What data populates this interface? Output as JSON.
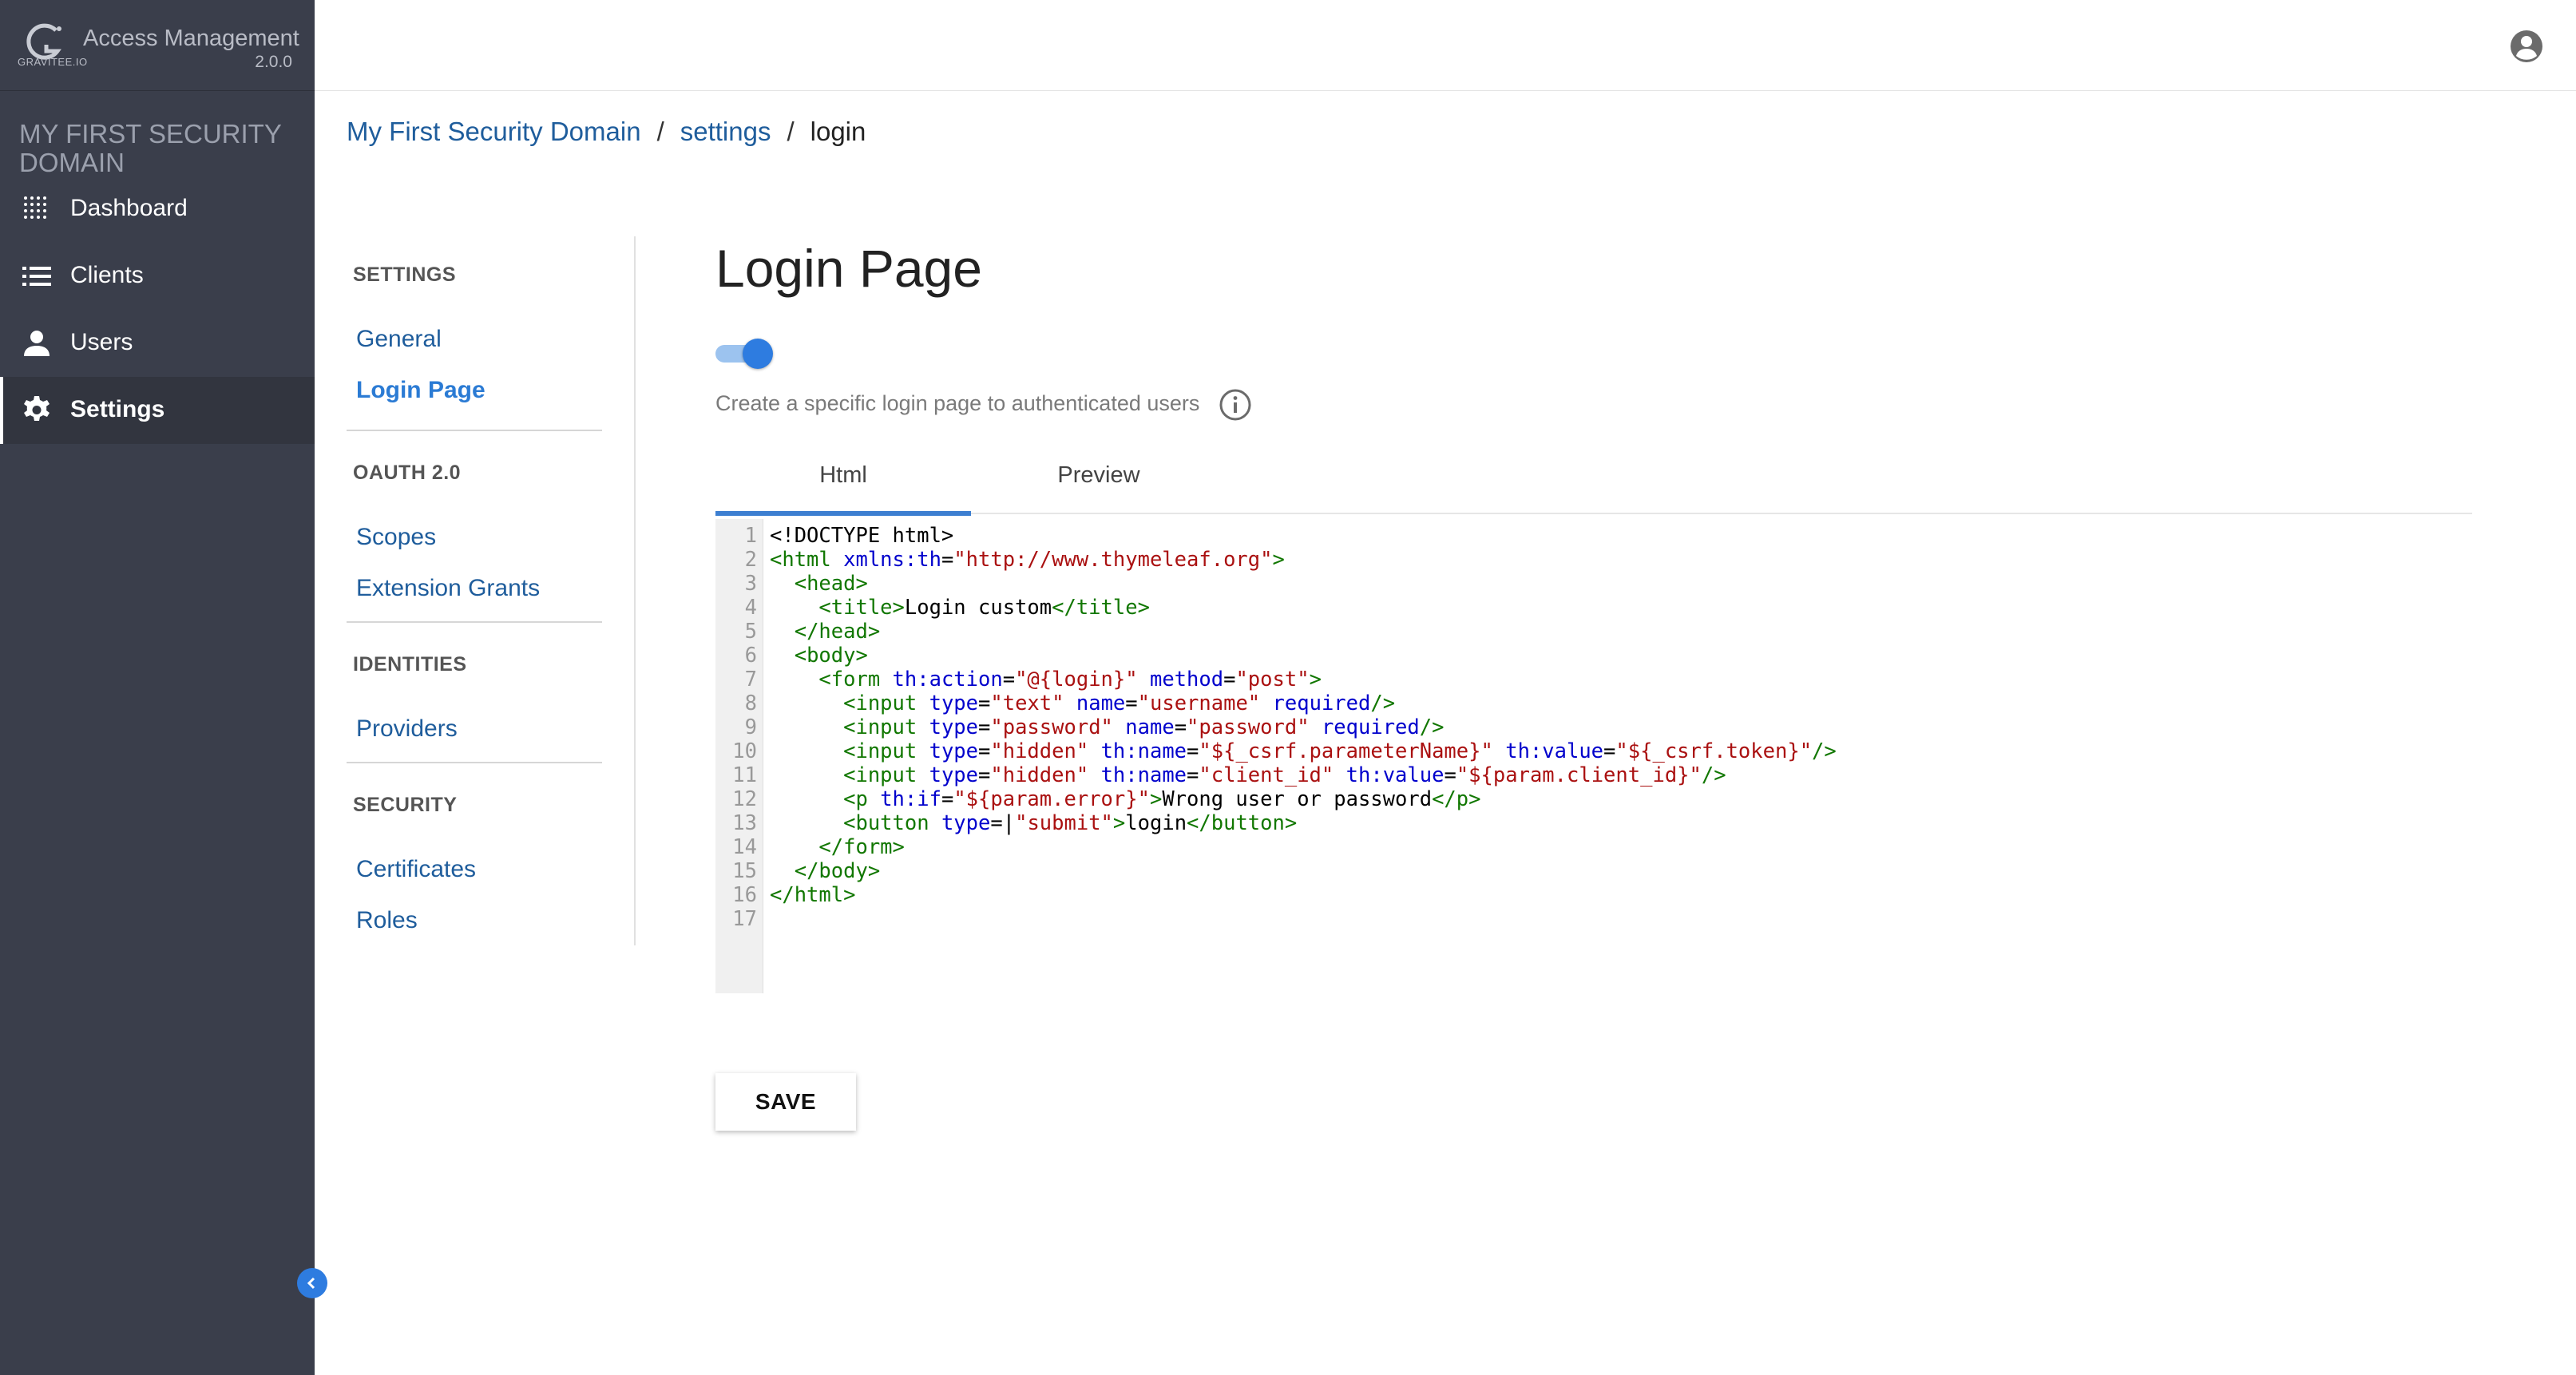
{
  "app": {
    "logo_text": "GRAVITEE.IO",
    "name": "Access Management",
    "version": "2.0.0"
  },
  "sidebar": {
    "domain_title": "MY FIRST SECURITY DOMAIN",
    "items": [
      {
        "label": "Dashboard",
        "icon": "dashboard-dots-icon",
        "active": false
      },
      {
        "label": "Clients",
        "icon": "list-icon",
        "active": false
      },
      {
        "label": "Users",
        "icon": "person-icon",
        "active": false
      },
      {
        "label": "Settings",
        "icon": "gear-icon",
        "active": true
      }
    ]
  },
  "breadcrumb": {
    "domain": "My First Security Domain",
    "settings": "settings",
    "current": "login",
    "separator": "/"
  },
  "subnav": {
    "sections": [
      {
        "title": "SETTINGS",
        "links": [
          {
            "label": "General",
            "active": false
          },
          {
            "label": "Login Page",
            "active": true
          }
        ]
      },
      {
        "title": "OAUTH 2.0",
        "links": [
          {
            "label": "Scopes",
            "active": false
          },
          {
            "label": "Extension Grants",
            "active": false
          }
        ]
      },
      {
        "title": "IDENTITIES",
        "links": [
          {
            "label": "Providers",
            "active": false
          }
        ]
      },
      {
        "title": "SECURITY",
        "links": [
          {
            "label": "Certificates",
            "active": false
          },
          {
            "label": "Roles",
            "active": false
          }
        ]
      }
    ]
  },
  "main": {
    "title": "Login Page",
    "toggle_enabled": true,
    "toggle_description": "Create a specific login page to authenticated users",
    "tabs": [
      {
        "label": "Html",
        "active": true
      },
      {
        "label": "Preview",
        "active": false
      }
    ],
    "editor_lines": [
      [
        {
          "t": "txt",
          "v": "<!DOCTYPE html>"
        }
      ],
      [
        {
          "t": "tag",
          "v": "<html "
        },
        {
          "t": "attr",
          "v": "xmlns:th"
        },
        {
          "t": "txt",
          "v": "="
        },
        {
          "t": "str",
          "v": "\"http://www.thymeleaf.org\""
        },
        {
          "t": "tag",
          "v": ">"
        }
      ],
      [
        {
          "t": "txt",
          "v": "  "
        },
        {
          "t": "tag",
          "v": "<head>"
        }
      ],
      [
        {
          "t": "txt",
          "v": "    "
        },
        {
          "t": "tag",
          "v": "<title>"
        },
        {
          "t": "txt",
          "v": "Login custom"
        },
        {
          "t": "tag",
          "v": "</title>"
        }
      ],
      [
        {
          "t": "txt",
          "v": "  "
        },
        {
          "t": "tag",
          "v": "</head>"
        }
      ],
      [
        {
          "t": "txt",
          "v": "  "
        },
        {
          "t": "tag",
          "v": "<body>"
        }
      ],
      [
        {
          "t": "txt",
          "v": "    "
        },
        {
          "t": "tag",
          "v": "<form "
        },
        {
          "t": "attr",
          "v": "th:action"
        },
        {
          "t": "txt",
          "v": "="
        },
        {
          "t": "str",
          "v": "\"@{login}\""
        },
        {
          "t": "txt",
          "v": " "
        },
        {
          "t": "attr",
          "v": "method"
        },
        {
          "t": "txt",
          "v": "="
        },
        {
          "t": "str",
          "v": "\"post\""
        },
        {
          "t": "tag",
          "v": ">"
        }
      ],
      [
        {
          "t": "txt",
          "v": "      "
        },
        {
          "t": "tag",
          "v": "<input "
        },
        {
          "t": "attr",
          "v": "type"
        },
        {
          "t": "txt",
          "v": "="
        },
        {
          "t": "str",
          "v": "\"text\""
        },
        {
          "t": "txt",
          "v": " "
        },
        {
          "t": "attr",
          "v": "name"
        },
        {
          "t": "txt",
          "v": "="
        },
        {
          "t": "str",
          "v": "\"username\""
        },
        {
          "t": "txt",
          "v": " "
        },
        {
          "t": "attr",
          "v": "required"
        },
        {
          "t": "tag",
          "v": "/>"
        }
      ],
      [
        {
          "t": "txt",
          "v": "      "
        },
        {
          "t": "tag",
          "v": "<input "
        },
        {
          "t": "attr",
          "v": "type"
        },
        {
          "t": "txt",
          "v": "="
        },
        {
          "t": "str",
          "v": "\"password\""
        },
        {
          "t": "txt",
          "v": " "
        },
        {
          "t": "attr",
          "v": "name"
        },
        {
          "t": "txt",
          "v": "="
        },
        {
          "t": "str",
          "v": "\"password\""
        },
        {
          "t": "txt",
          "v": " "
        },
        {
          "t": "attr",
          "v": "required"
        },
        {
          "t": "tag",
          "v": "/>"
        }
      ],
      [
        {
          "t": "txt",
          "v": "      "
        },
        {
          "t": "tag",
          "v": "<input "
        },
        {
          "t": "attr",
          "v": "type"
        },
        {
          "t": "txt",
          "v": "="
        },
        {
          "t": "str",
          "v": "\"hidden\""
        },
        {
          "t": "txt",
          "v": " "
        },
        {
          "t": "attr",
          "v": "th:name"
        },
        {
          "t": "txt",
          "v": "="
        },
        {
          "t": "str",
          "v": "\"${_csrf.parameterName}\""
        },
        {
          "t": "txt",
          "v": " "
        },
        {
          "t": "attr",
          "v": "th:value"
        },
        {
          "t": "txt",
          "v": "="
        },
        {
          "t": "str",
          "v": "\"${_csrf.token}\""
        },
        {
          "t": "tag",
          "v": "/>"
        }
      ],
      [
        {
          "t": "txt",
          "v": "      "
        },
        {
          "t": "tag",
          "v": "<input "
        },
        {
          "t": "attr",
          "v": "type"
        },
        {
          "t": "txt",
          "v": "="
        },
        {
          "t": "str",
          "v": "\"hidden\""
        },
        {
          "t": "txt",
          "v": " "
        },
        {
          "t": "attr",
          "v": "th:name"
        },
        {
          "t": "txt",
          "v": "="
        },
        {
          "t": "str",
          "v": "\"client_id\""
        },
        {
          "t": "txt",
          "v": " "
        },
        {
          "t": "attr",
          "v": "th:value"
        },
        {
          "t": "txt",
          "v": "="
        },
        {
          "t": "str",
          "v": "\"${param.client_id}\""
        },
        {
          "t": "tag",
          "v": "/>"
        }
      ],
      [
        {
          "t": "txt",
          "v": "      "
        },
        {
          "t": "tag",
          "v": "<p "
        },
        {
          "t": "attr",
          "v": "th:if"
        },
        {
          "t": "txt",
          "v": "="
        },
        {
          "t": "str",
          "v": "\"${param.error}\""
        },
        {
          "t": "tag",
          "v": ">"
        },
        {
          "t": "txt",
          "v": "Wrong user or password"
        },
        {
          "t": "tag",
          "v": "</p>"
        }
      ],
      [
        {
          "t": "txt",
          "v": "      "
        },
        {
          "t": "tag",
          "v": "<button "
        },
        {
          "t": "attr",
          "v": "type"
        },
        {
          "t": "txt",
          "v": "=|"
        },
        {
          "t": "str",
          "v": "\"submit\""
        },
        {
          "t": "tag",
          "v": ">"
        },
        {
          "t": "txt",
          "v": "login"
        },
        {
          "t": "tag",
          "v": "</button>"
        }
      ],
      [
        {
          "t": "txt",
          "v": "    "
        },
        {
          "t": "tag",
          "v": "</form>"
        }
      ],
      [
        {
          "t": "txt",
          "v": "  "
        },
        {
          "t": "tag",
          "v": "</body>"
        }
      ],
      [
        {
          "t": "tag",
          "v": "</html>"
        }
      ],
      []
    ],
    "save_label": "SAVE"
  },
  "colors": {
    "sidebar_bg": "#3a3e4b",
    "accent": "#2e7ce0",
    "link": "#1f5d9c",
    "code_tag": "#117700",
    "code_attr": "#0000cc",
    "code_string": "#aa1111"
  }
}
